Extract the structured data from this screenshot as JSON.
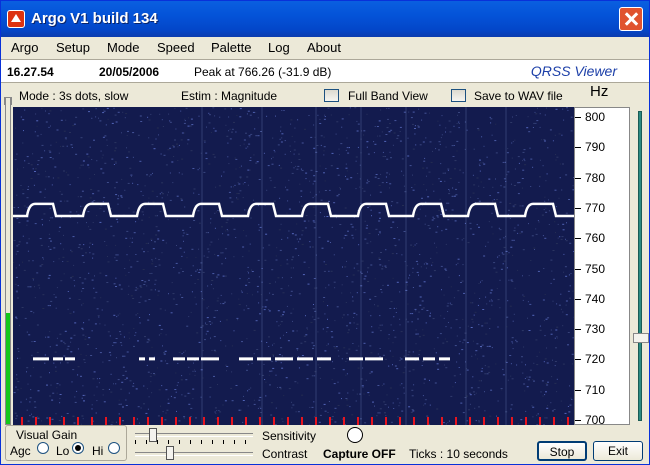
{
  "window": {
    "title": "Argo V1 build 134"
  },
  "menu": [
    "Argo",
    "Setup",
    "Mode",
    "Speed",
    "Palette",
    "Log",
    "About"
  ],
  "status": {
    "time": "16.27.54",
    "date": "20/05/2006",
    "peak": "Peak at 766.26 (-31.9 dB)",
    "app_name": "QRSS Viewer"
  },
  "options": {
    "mode": "Mode : 3s dots, slow",
    "estim": "Estim : Magnitude",
    "full_band_view": "Full Band View",
    "save_wav": "Save to WAV file",
    "unit": "Hz"
  },
  "level_meter": {
    "fill_fraction": 0.34,
    "color": "#13c71a"
  },
  "scale": {
    "ticks": [
      "800",
      "790",
      "780",
      "770",
      "760",
      "750",
      "740",
      "730",
      "720",
      "710",
      "700"
    ]
  },
  "waterfall": {
    "background": "#131b4e",
    "trace_color": "#ffffff",
    "marker_color": "#e8141e",
    "freq_min": 698,
    "freq_max": 803
  },
  "bottom": {
    "visual_gain": "Visual Gain",
    "agc": "Agc",
    "lo": "Lo",
    "hi": "Hi",
    "sensitivity": "Sensitivity",
    "contrast": "Contrast",
    "capture": "Capture OFF",
    "ticks": "Ticks   : 10 seconds",
    "stop": "Stop",
    "exit": "Exit"
  }
}
